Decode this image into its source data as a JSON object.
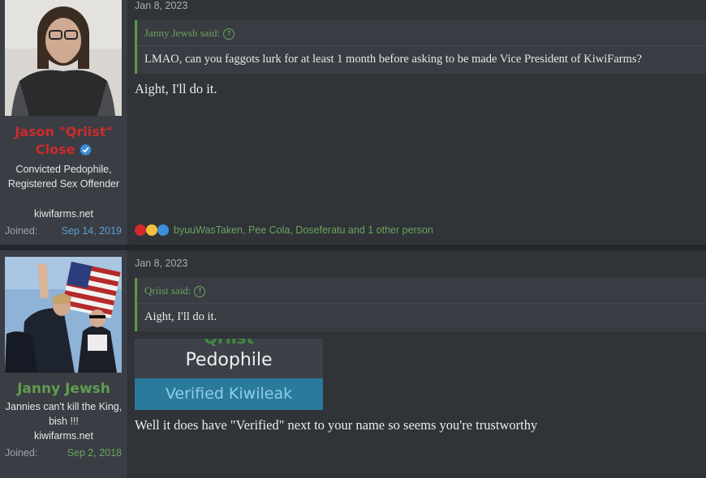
{
  "posts": [
    {
      "username": "Jason \"Qriist\" Close",
      "username_line1": "Jason \"Qriist\"",
      "username_line2": "Close",
      "user_title": "Convicted Pedophile, Registered Sex Offender",
      "website": "kiwifarms.net",
      "joined_label": "Joined:",
      "joined_date": "Sep 14, 2019",
      "post_date": "Jan 8, 2023",
      "quote": {
        "author": "Janny Jewsh said:",
        "text": "LMAO, can you faggots lurk for at least 1 month before asking to be made Vice President of KiwiFarms?"
      },
      "message": "Aight, I'll do it.",
      "reactions_text": "byuuWasTaken, Pee Cola, Doseferatu and 1 other person"
    },
    {
      "username": "Janny Jewsh",
      "user_title": "Jannies can't kill the King, bish !!!",
      "website": "kiwifarms.net",
      "joined_label": "Joined:",
      "joined_date": "Sep 2, 2018",
      "post_date": "Jan 8, 2023",
      "quote": {
        "author": "Qriist said:",
        "text": "Aight, I'll do it."
      },
      "embedded_image": {
        "partial_top_text": "Qriist",
        "line1": "Pedophile",
        "line2": "Verified Kiwileak"
      },
      "message": "Well it does have \"Verified\" next to your name so seems you're trustworthy"
    }
  ],
  "icons": {
    "verified": "verified-badge-icon",
    "quote_jump": "arrow-up-circle-icon",
    "reactions": [
      "heart-icon",
      "thinking-icon",
      "thumbs-up-icon"
    ]
  },
  "colors": {
    "username_red": "#cc2b2b",
    "username_green": "#5f9e4f",
    "link_blue": "#5a9fd6",
    "link_green": "#6aa55e",
    "quote_border": "#5c9a4f",
    "badge_blue": "#2a7a9c"
  }
}
